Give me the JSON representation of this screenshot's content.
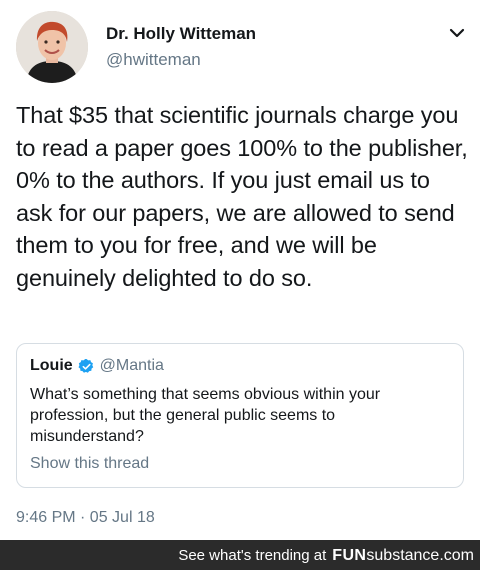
{
  "author": {
    "display_name": "Dr. Holly Witteman",
    "handle": "@hwitteman",
    "avatar_icon": "profile-photo"
  },
  "tweet": {
    "text": "That $35 that scientific journals charge you to read a paper goes 100% to the publisher, 0% to the authors. If you just email us to ask for our papers, we are allowed to send them to you for free, and we will be genuinely delighted to do so.",
    "timestamp": "9:46 PM · 05 Jul 18"
  },
  "quoted_tweet": {
    "display_name": "Louie",
    "handle": "@Mantia",
    "verified_icon": "verified-badge-icon",
    "text": "What’s something that seems obvious within your profession, but the general public seems to misunderstand?",
    "show_thread_label": "Show this thread"
  },
  "footer": {
    "trending_text": "See what's trending at",
    "brand_part1": "FUN",
    "brand_part2": "substance",
    "brand_part3": ".com"
  },
  "colors": {
    "text_primary": "#14171a",
    "text_secondary": "#657786",
    "verified_blue": "#1da1f2",
    "border": "#d6dde3",
    "footer_bg": "#2b2b2b"
  }
}
